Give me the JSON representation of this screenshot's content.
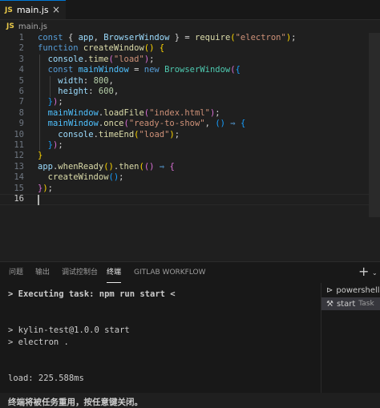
{
  "tab": {
    "badge": "JS",
    "label": "main.js",
    "close_glyph": "×"
  },
  "breadcrumb": {
    "badge": "JS",
    "label": "main.js"
  },
  "editor": {
    "active_line": 16,
    "lines": [
      {
        "n": "1",
        "tokens": [
          [
            "kw",
            "const "
          ],
          [
            "p",
            "{ "
          ],
          [
            "var",
            "app"
          ],
          [
            "p",
            ", "
          ],
          [
            "var",
            "BrowserWindow"
          ],
          [
            "p",
            " } = "
          ],
          [
            "fn",
            "require"
          ],
          [
            "b1",
            "("
          ],
          [
            "str",
            "\"electron\""
          ],
          [
            "b1",
            ")"
          ],
          [
            "p",
            ";"
          ]
        ]
      },
      {
        "n": "2",
        "tokens": [
          [
            "kw",
            "function "
          ],
          [
            "fn",
            "createWindow"
          ],
          [
            "b1",
            "()"
          ],
          [
            "p",
            " "
          ],
          [
            "b1",
            "{"
          ]
        ]
      },
      {
        "n": "3",
        "tokens": [
          [
            "p",
            "  "
          ],
          [
            "var",
            "console"
          ],
          [
            "p",
            "."
          ],
          [
            "fn",
            "time"
          ],
          [
            "b2",
            "("
          ],
          [
            "str",
            "\"load\""
          ],
          [
            "b2",
            ")"
          ],
          [
            "p",
            ";"
          ]
        ]
      },
      {
        "n": "4",
        "tokens": [
          [
            "p",
            "  "
          ],
          [
            "kw",
            "const "
          ],
          [
            "const",
            "mainWindow"
          ],
          [
            "p",
            " = "
          ],
          [
            "kw",
            "new "
          ],
          [
            "cls",
            "BrowserWindow"
          ],
          [
            "b2",
            "("
          ],
          [
            "b3",
            "{"
          ]
        ]
      },
      {
        "n": "5",
        "tokens": [
          [
            "p",
            "    "
          ],
          [
            "var",
            "width"
          ],
          [
            "p",
            ": "
          ],
          [
            "num",
            "800"
          ],
          [
            "p",
            ","
          ]
        ]
      },
      {
        "n": "6",
        "tokens": [
          [
            "p",
            "    "
          ],
          [
            "var",
            "height"
          ],
          [
            "p",
            ": "
          ],
          [
            "num",
            "600"
          ],
          [
            "p",
            ","
          ]
        ]
      },
      {
        "n": "7",
        "tokens": [
          [
            "p",
            "  "
          ],
          [
            "b3",
            "}"
          ],
          [
            "b2",
            ")"
          ],
          [
            "p",
            ";"
          ]
        ]
      },
      {
        "n": "8",
        "tokens": [
          [
            "p",
            "  "
          ],
          [
            "const",
            "mainWindow"
          ],
          [
            "p",
            "."
          ],
          [
            "fn",
            "loadFile"
          ],
          [
            "b2",
            "("
          ],
          [
            "str",
            "\"index.html\""
          ],
          [
            "b2",
            ")"
          ],
          [
            "p",
            ";"
          ]
        ]
      },
      {
        "n": "9",
        "tokens": [
          [
            "p",
            "  "
          ],
          [
            "const",
            "mainWindow"
          ],
          [
            "p",
            "."
          ],
          [
            "fn",
            "once"
          ],
          [
            "b2",
            "("
          ],
          [
            "str",
            "\"ready-to-show\""
          ],
          [
            "p",
            ", "
          ],
          [
            "b3",
            "()"
          ],
          [
            "p",
            " "
          ],
          [
            "kw",
            "⇒"
          ],
          [
            "p",
            " "
          ],
          [
            "b3",
            "{"
          ]
        ]
      },
      {
        "n": "10",
        "tokens": [
          [
            "p",
            "    "
          ],
          [
            "var",
            "console"
          ],
          [
            "p",
            "."
          ],
          [
            "fn",
            "timeEnd"
          ],
          [
            "b1",
            "("
          ],
          [
            "str",
            "\"load\""
          ],
          [
            "b1",
            ")"
          ],
          [
            "p",
            ";"
          ]
        ]
      },
      {
        "n": "11",
        "tokens": [
          [
            "p",
            "  "
          ],
          [
            "b3",
            "}"
          ],
          [
            "b2",
            ")"
          ],
          [
            "p",
            ";"
          ]
        ]
      },
      {
        "n": "12",
        "tokens": [
          [
            "b1",
            "}"
          ]
        ]
      },
      {
        "n": "13",
        "tokens": [
          [
            "var",
            "app"
          ],
          [
            "p",
            "."
          ],
          [
            "fn",
            "whenReady"
          ],
          [
            "b1",
            "()"
          ],
          [
            "p",
            "."
          ],
          [
            "fn",
            "then"
          ],
          [
            "b1",
            "("
          ],
          [
            "b2",
            "()"
          ],
          [
            "p",
            " "
          ],
          [
            "kw",
            "⇒"
          ],
          [
            "p",
            " "
          ],
          [
            "b2",
            "{"
          ]
        ]
      },
      {
        "n": "14",
        "tokens": [
          [
            "p",
            "  "
          ],
          [
            "fn",
            "createWindow"
          ],
          [
            "b3",
            "()"
          ],
          [
            "p",
            ";"
          ]
        ]
      },
      {
        "n": "15",
        "tokens": [
          [
            "b2",
            "}"
          ],
          [
            "b1",
            ")"
          ],
          [
            "p",
            ";"
          ]
        ]
      },
      {
        "n": "16",
        "tokens": []
      }
    ]
  },
  "panel": {
    "tabs": [
      {
        "label": "问题",
        "active": false
      },
      {
        "label": "输出",
        "active": false
      },
      {
        "label": "调试控制台",
        "active": false
      },
      {
        "label": "终端",
        "active": true
      },
      {
        "label": "GITLAB WORKFLOW",
        "active": false
      }
    ],
    "plus_glyph": "+",
    "chevron_glyph": "⌄",
    "terminal_lines": [
      {
        "text": "> Executing task: npm run start <",
        "bold": true
      },
      {
        "text": "",
        "bold": false
      },
      {
        "text": "",
        "bold": false
      },
      {
        "text": "> kylin-test@1.0.0 start",
        "bold": false
      },
      {
        "text": "> electron .",
        "bold": false
      },
      {
        "text": "",
        "bold": false
      },
      {
        "text": "",
        "bold": false
      },
      {
        "text": "load: 225.588ms",
        "bold": false
      },
      {
        "text": "",
        "bold": false
      },
      {
        "text": "终端将被任务重用，按任意键关闭。",
        "bold": true
      }
    ],
    "terminal_list": [
      {
        "icon": "terminal-icon",
        "glyph": "⊳",
        "label": "powershell",
        "sub": "",
        "active": false
      },
      {
        "icon": "tools-icon",
        "glyph": "⚒",
        "label": "start",
        "sub": "Task",
        "active": true
      }
    ]
  }
}
